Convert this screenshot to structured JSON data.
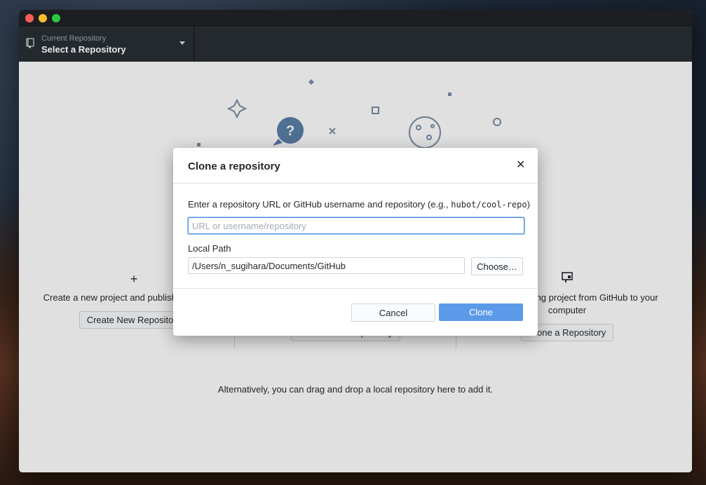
{
  "toolbar": {
    "repo_caption": "Current Repository",
    "repo_title": "Select a Repository"
  },
  "welcome": {
    "create": {
      "icon": "plus-icon",
      "text": "Create a new project and publish it to GitHub",
      "button": "Create New Repository"
    },
    "add": {
      "icon": "folder-icon",
      "button": "Add a Local Repository"
    },
    "clone": {
      "icon": "device-desktop-icon",
      "text": "Clone an existing project from GitHub to your computer",
      "button": "Clone a Repository"
    },
    "alt_text": "Alternatively, you can drag and drop a local repository here to add it."
  },
  "dialog": {
    "title": "Clone a repository",
    "instruction_text": "Enter a repository URL or GitHub username and repository (e.g., ",
    "instruction_example": "hubot/cool-repo",
    "instruction_suffix": ")",
    "url_placeholder": "URL or username/repository",
    "url_value": "",
    "local_path_label": "Local Path",
    "local_path_value": "/Users/n_sugihara/Documents/GitHub",
    "choose_label": "Choose…",
    "cancel_label": "Cancel",
    "clone_label": "Clone"
  },
  "colors": {
    "accent": "#5b9ae8",
    "toolbar_bg": "#24292e",
    "close": "#fc5f57",
    "minimize": "#fdbc2e",
    "maximize": "#28c840"
  }
}
